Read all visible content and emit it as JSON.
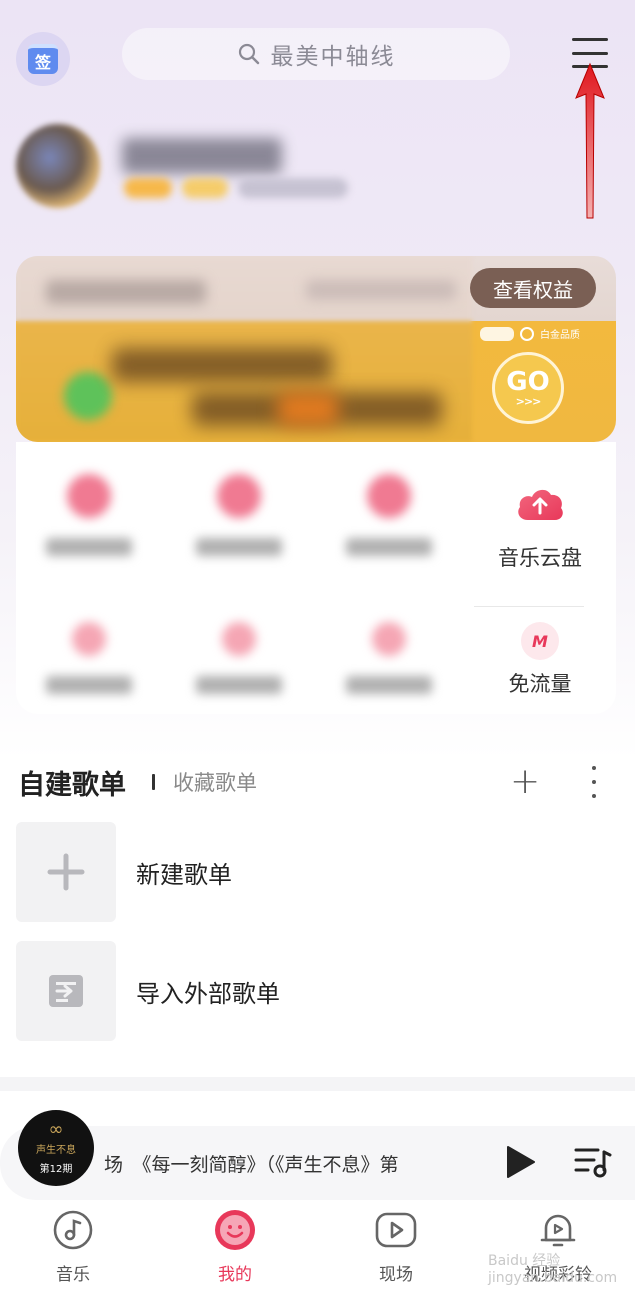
{
  "header": {
    "sign_label": "签",
    "search_placeholder": "最美中轴线"
  },
  "vip": {
    "benefit_button": "查看权益",
    "go_label": "GO",
    "go_sub": ">>>",
    "brand_label": "白金品质"
  },
  "tools": {
    "cloud_label": "音乐云盘",
    "traffic_label": "免流量",
    "mzone_text": "M"
  },
  "playlists": {
    "tab_created": "自建歌单",
    "tab_collected": "收藏歌单",
    "items": [
      {
        "label": "新建歌单"
      },
      {
        "label": "导入外部歌单"
      }
    ]
  },
  "player": {
    "title": "场　《每一刻简醇》（《声生不息》第",
    "disc_logo": "∞",
    "disc_sub": "声生不息",
    "disc_episode": "第12期"
  },
  "tabbar": {
    "tabs": [
      {
        "label": "音乐"
      },
      {
        "label": "我的"
      },
      {
        "label": "现场"
      },
      {
        "label": "视频彩铃"
      }
    ]
  },
  "watermark": "Baidu 经验 jingyan.baidu.com",
  "colors": {
    "accent": "#e8385a",
    "benefit_btn": "#7a5f54",
    "vip_gold": "#f3b93e"
  }
}
